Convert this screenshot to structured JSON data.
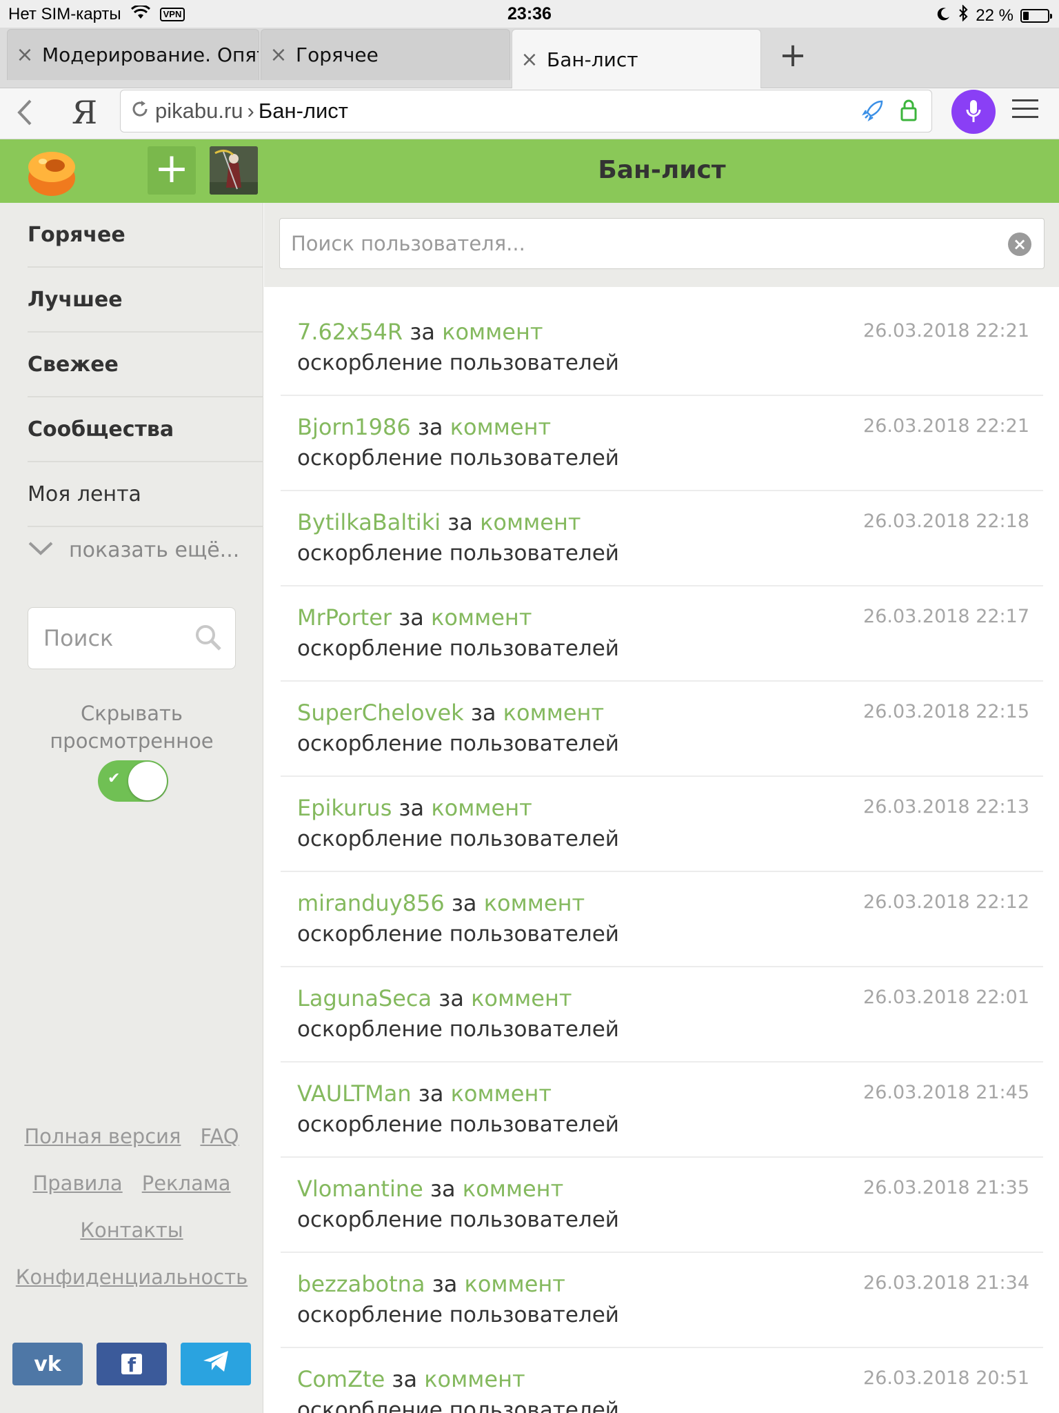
{
  "status": {
    "carrier": "Нет SIM-карты",
    "vpn": "VPN",
    "time": "23:36",
    "battery": "22 %",
    "battery_level": 0.22
  },
  "tabs": [
    {
      "title": "Модерирование. Опят"
    },
    {
      "title": "Горячее"
    },
    {
      "title": "Бан-лист"
    }
  ],
  "address": {
    "ya": "Я",
    "host": "pikabu.ru",
    "sep": "›",
    "path": "Бан-лист"
  },
  "header": {
    "title": "Бан-лист"
  },
  "sidebar": {
    "items": [
      {
        "label": "Горячее"
      },
      {
        "label": "Лучшее"
      },
      {
        "label": "Свежее"
      },
      {
        "label": "Сообщества"
      },
      {
        "label": "Моя лента"
      }
    ],
    "more": "показать ещё...",
    "search_placeholder": "Поиск",
    "hide_viewed": "Скрывать просмотренное",
    "footer": {
      "full_version": "Полная версия",
      "faq": "FAQ",
      "rules": "Правила",
      "ads": "Реклама",
      "contacts": "Контакты",
      "privacy": "Конфиденциальность"
    },
    "social": {
      "vk": "vk",
      "fb": "f"
    }
  },
  "main": {
    "search_placeholder": "Поиск пользователя...",
    "for_word": "за",
    "link_word": "коммент",
    "reason": "оскорбление пользователей",
    "bans": [
      {
        "user": "7.62x54R",
        "date": "26.03.2018 22:21"
      },
      {
        "user": "Bjorn1986",
        "date": "26.03.2018 22:21"
      },
      {
        "user": "BytilkaBaltiki",
        "date": "26.03.2018 22:18"
      },
      {
        "user": "MrPorter",
        "date": "26.03.2018 22:17"
      },
      {
        "user": "SuperChelovek",
        "date": "26.03.2018 22:15"
      },
      {
        "user": "Epikurus",
        "date": "26.03.2018 22:13"
      },
      {
        "user": "miranduy856",
        "date": "26.03.2018 22:12"
      },
      {
        "user": "LagunaSeca",
        "date": "26.03.2018 22:01"
      },
      {
        "user": "VAULTMan",
        "date": "26.03.2018 21:45"
      },
      {
        "user": "Vlomantine",
        "date": "26.03.2018 21:35"
      },
      {
        "user": "bezzabotna",
        "date": "26.03.2018 21:34"
      },
      {
        "user": "ComZte",
        "date": "26.03.2018 20:51"
      }
    ]
  }
}
